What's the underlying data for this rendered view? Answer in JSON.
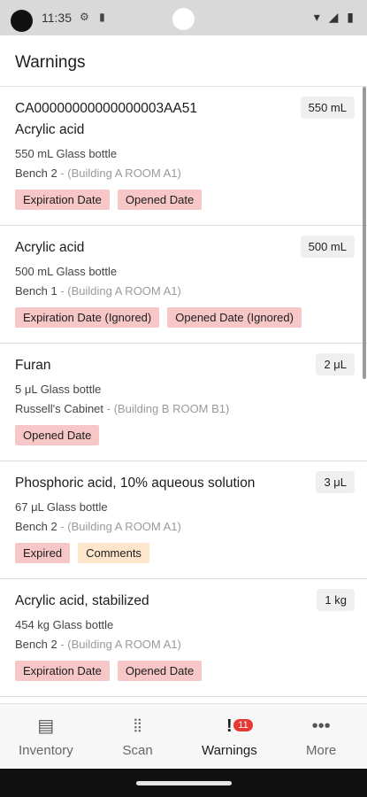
{
  "status_bar": {
    "time": "11:35",
    "left_icons": "⚙ ▮",
    "right_icons": "▾ ◢ ▮"
  },
  "header": {
    "title": "Warnings"
  },
  "items": [
    {
      "title": "CA00000000000000003AA51",
      "subtitle": "Acrylic acid",
      "quantity": "550 mL",
      "container": "550 mL Glass bottle",
      "location": "Bench 2",
      "location_detail": " - (Building A ROOM A1)",
      "tags": [
        {
          "label": "Expiration Date",
          "color": "#f7c6c6"
        },
        {
          "label": "Opened Date",
          "color": "#f7c6c6"
        }
      ]
    },
    {
      "title": "Acrylic acid",
      "quantity": "500 mL",
      "container": "500 mL Glass bottle",
      "location": "Bench 1",
      "location_detail": " - (Building A ROOM A1)",
      "tags": [
        {
          "label": "Expiration Date  (Ignored)",
          "color": "#f7c6c6"
        },
        {
          "label": "Opened Date  (Ignored)",
          "color": "#f7c6c6"
        }
      ]
    },
    {
      "title": "Furan",
      "quantity": "2 μL",
      "container": "5 μL Glass bottle",
      "location": "Russell's Cabinet",
      "location_detail": " - (Building B ROOM B1)",
      "tags": [
        {
          "label": "Opened Date",
          "color": "#f7c6c6"
        }
      ]
    },
    {
      "title": "Phosphoric acid, 10% aqueous solution",
      "quantity": "3 μL",
      "container": "67 μL Glass bottle",
      "location": "Bench 2",
      "location_detail": " - (Building A ROOM A1)",
      "tags": [
        {
          "label": "Expired",
          "color": "#f7c6c6"
        },
        {
          "label": "Comments",
          "color": "#fde6cc"
        }
      ]
    },
    {
      "title": "Acrylic acid, stabilized",
      "quantity": "1 kg",
      "container": "454 kg Glass bottle",
      "location": "Bench 2",
      "location_detail": " - (Building A ROOM A1)",
      "tags": [
        {
          "label": "Expiration Date",
          "color": "#f7c6c6"
        },
        {
          "label": "Opened Date",
          "color": "#f7c6c6"
        }
      ]
    }
  ],
  "bottom_nav": {
    "items": [
      {
        "label": "Inventory",
        "icon": "archive-box-icon",
        "glyph": "▤"
      },
      {
        "label": "Scan",
        "icon": "barcode-scan-icon",
        "glyph": "⦙⦙"
      },
      {
        "label": "Warnings",
        "icon": "alert-message-icon",
        "glyph": "!"
      },
      {
        "label": "More",
        "icon": "more-dots-icon",
        "glyph": "•••"
      }
    ],
    "active": "Warnings",
    "warnings_badge": "11"
  },
  "colors": {
    "tag_red": "#f7c6c6",
    "tag_amber": "#fde6cc",
    "badge_red": "#e53935"
  }
}
